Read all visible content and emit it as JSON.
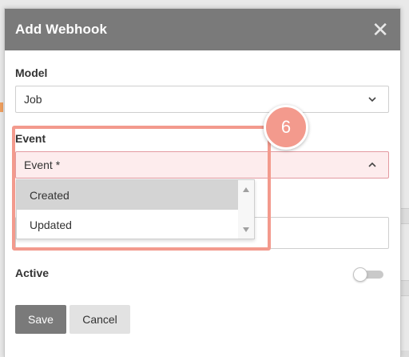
{
  "dialog": {
    "title": "Add Webhook",
    "close_icon": "close-icon"
  },
  "model": {
    "label": "Model",
    "value": "Job"
  },
  "event": {
    "label": "Event",
    "placeholder": "Event *",
    "options": [
      "Created",
      "Updated"
    ],
    "highlighted_option": "Created"
  },
  "annotation": {
    "step": "6",
    "color": "#f39a8d"
  },
  "active": {
    "label": "Active",
    "on": false
  },
  "actions": {
    "save_label": "Save",
    "cancel_label": "Cancel"
  },
  "colors": {
    "header": "#7a7a7a",
    "error_bg": "#fdeced",
    "error_border": "#e29aa0"
  }
}
